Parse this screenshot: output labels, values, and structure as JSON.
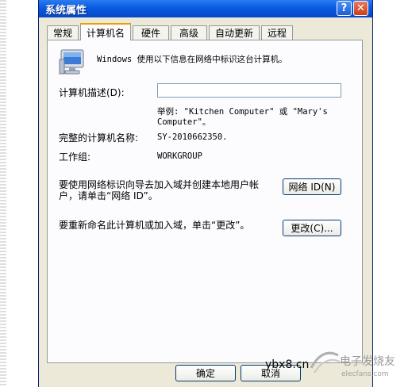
{
  "window": {
    "title": "系统属性",
    "help_label": "?",
    "close_label": "✕"
  },
  "tabs": [
    {
      "label": "常规"
    },
    {
      "label": "计算机名",
      "active": true
    },
    {
      "label": "硬件"
    },
    {
      "label": "高级"
    },
    {
      "label": "自动更新"
    },
    {
      "label": "远程"
    }
  ],
  "panel": {
    "intro_text": "Windows 使用以下信息在网络中标识这台计算机。",
    "description_label": "计算机描述(D):",
    "description_value": "",
    "example_line1": "举例: \"Kitchen Computer\" 或 \"Mary's",
    "example_line2": "Computer\"。",
    "full_name_label": "完整的计算机名称:",
    "full_name_value": "SY-2010662350.",
    "workgroup_label": "工作组:",
    "workgroup_value": "WORKGROUP",
    "network_id_text_line1": "要使用网络标识向导去加入域并创建本地用户帐",
    "network_id_text_line2": "户，请单击“网络 ID”。",
    "network_id_button": "网络 ID(N)",
    "rename_text": "要重新命名此计算机或加入域，单击“更改”。",
    "change_button": "更改(C)..."
  },
  "footer": {
    "ok_button": "确定",
    "cancel_button": "取消"
  },
  "watermark": {
    "site": "ybx8.cn",
    "logo_text": "电子发烧友",
    "logo_sub": "elecfans.com"
  },
  "icons": {
    "monitor": "computer-monitor-icon"
  }
}
